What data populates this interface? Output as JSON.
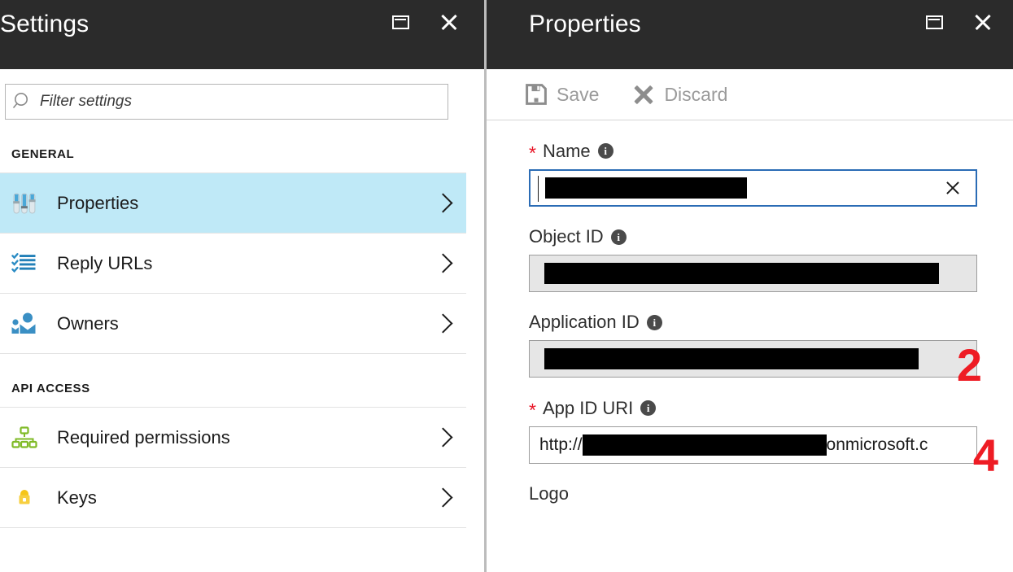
{
  "settings_blade": {
    "title": "Settings",
    "window_controls": [
      {
        "name": "restore-icon",
        "label": "Restore"
      },
      {
        "name": "close-icon",
        "label": "Close"
      }
    ],
    "filter": {
      "placeholder": "Filter settings",
      "value": "",
      "icon": "search-icon"
    },
    "groups": [
      {
        "label": "GENERAL",
        "items": [
          {
            "label": "Properties",
            "icon": "sliders-icon",
            "selected": true
          },
          {
            "label": "Reply URLs",
            "icon": "checklist-icon",
            "selected": false
          },
          {
            "label": "Owners",
            "icon": "people-icon",
            "selected": false
          }
        ]
      },
      {
        "label": "API ACCESS",
        "items": [
          {
            "label": "Required permissions",
            "icon": "hierarchy-icon",
            "selected": false
          },
          {
            "label": "Keys",
            "icon": "key-icon",
            "selected": false
          }
        ]
      }
    ]
  },
  "properties_blade": {
    "title": "Properties",
    "window_controls": [
      {
        "name": "restore-icon",
        "label": "Restore"
      },
      {
        "name": "close-icon",
        "label": "Close"
      }
    ],
    "command_bar": {
      "save_label": "Save",
      "discard_label": "Discard"
    },
    "fields": {
      "name": {
        "label": "Name",
        "required": true,
        "info": "i",
        "value": "",
        "redacted": true,
        "state": "focused",
        "clear_icon": "close-icon"
      },
      "object_id": {
        "label": "Object ID",
        "required": false,
        "info": "i",
        "value": "",
        "redacted": true,
        "state": "readonly"
      },
      "application_id": {
        "label": "Application ID",
        "required": false,
        "info": "i",
        "value": "",
        "redacted": true,
        "state": "readonly"
      },
      "app_id_uri": {
        "label": "App ID URI",
        "required": true,
        "info": "i",
        "prefix": "http://",
        "suffix": "onmicrosoft.c",
        "redacted": true,
        "state": "normal"
      },
      "logo": {
        "label": "Logo"
      }
    }
  },
  "annotations": [
    {
      "text": "2",
      "color": "#ee1c24"
    },
    {
      "text": "4",
      "color": "#ee1c24"
    }
  ]
}
